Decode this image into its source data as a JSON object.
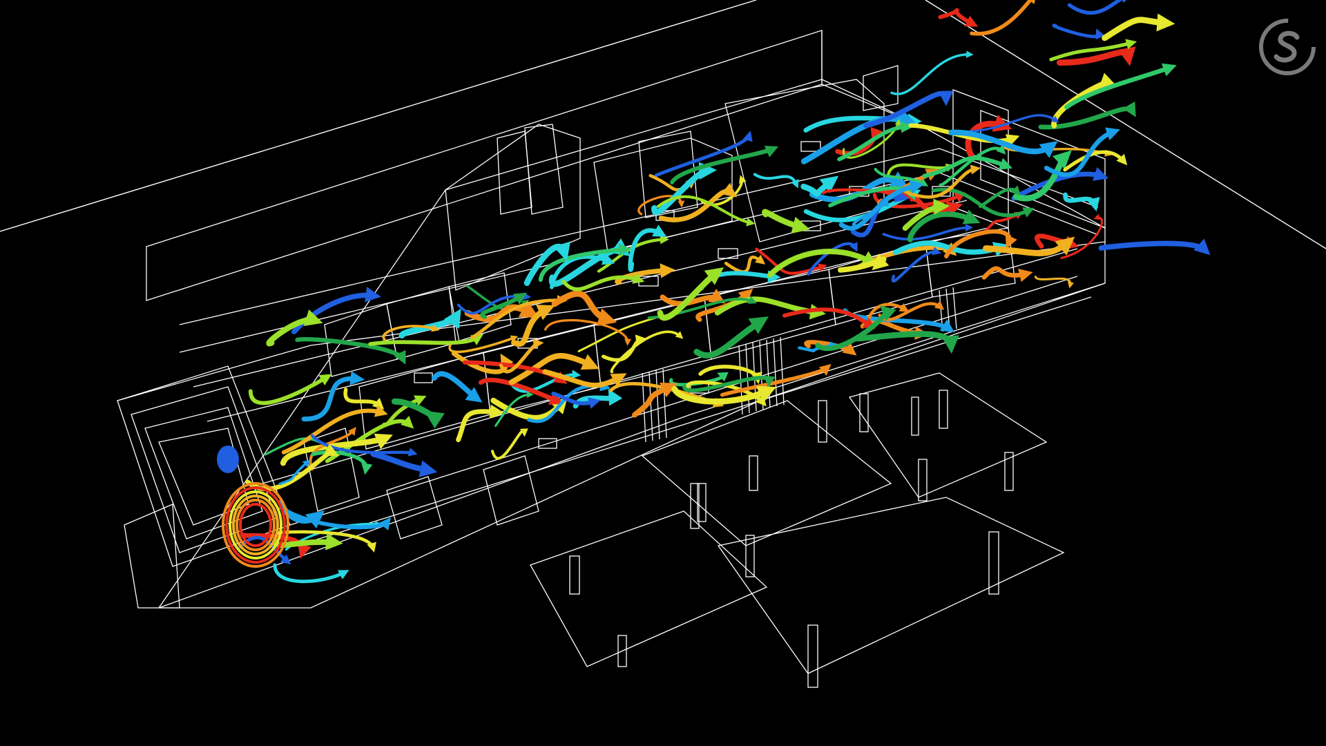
{
  "scene": {
    "background_color": "#000000",
    "wireframe_color": "#ffffff",
    "flow_palette": [
      "#1f5fe0",
      "#1aa0e8",
      "#28d6e0",
      "#2fc86a",
      "#22a64a",
      "#9be02a",
      "#e8e830",
      "#f0b020",
      "#f08a1a",
      "#e82a1a"
    ]
  },
  "logo": {
    "icon": "swirl-s-logo-icon",
    "color": "#7a7a7a"
  }
}
